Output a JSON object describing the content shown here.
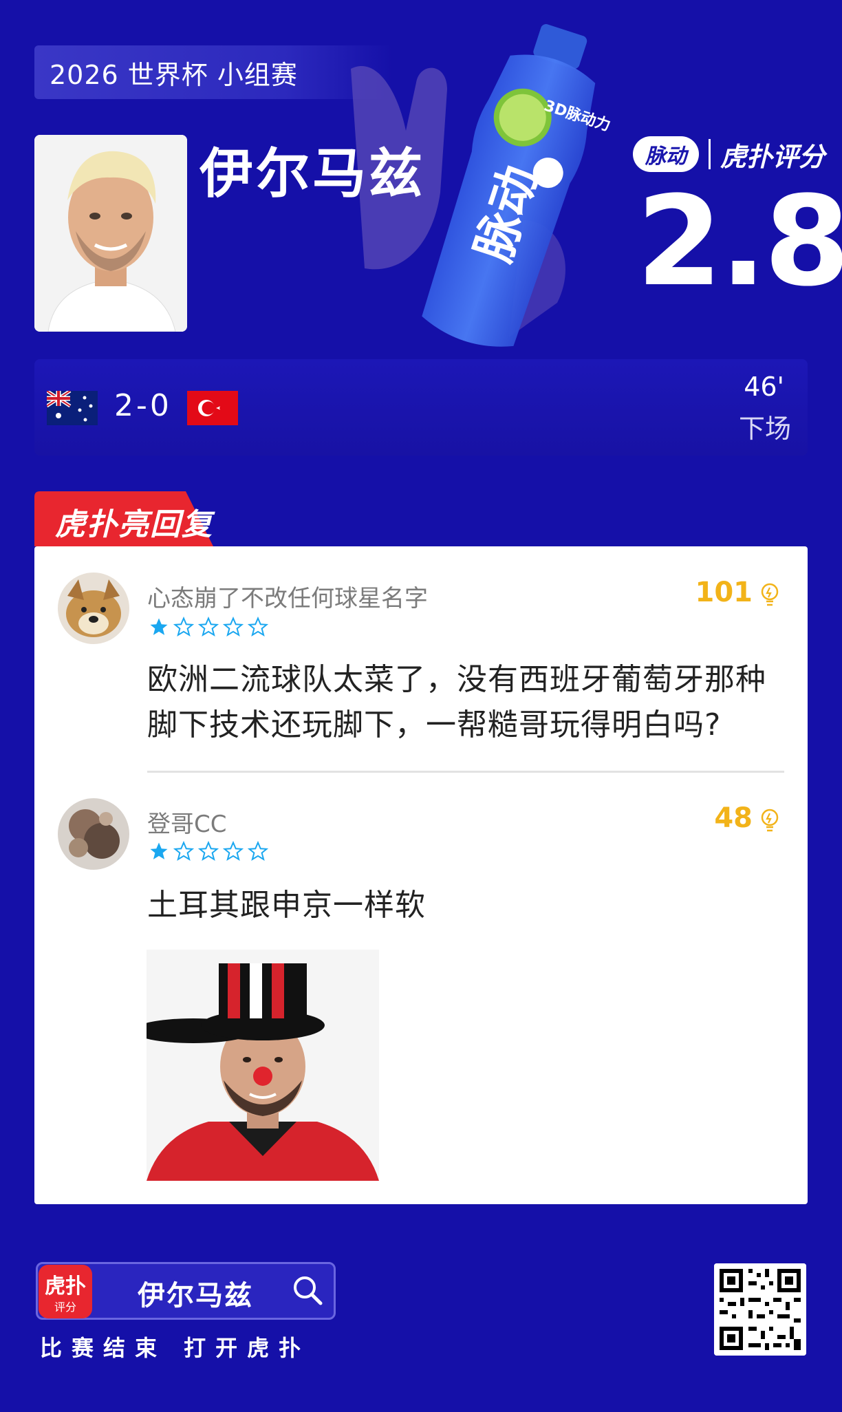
{
  "match": {
    "label": "2026 世界杯 小组赛",
    "score": "2-0",
    "minute": "46'",
    "status": "下场"
  },
  "player": {
    "name": "伊尔马兹",
    "rating": "2.8"
  },
  "brand": {
    "sponsor": "脉动",
    "rating_label": "虎扑评分"
  },
  "ad": {
    "bottle_text": "脉动",
    "badge": "3D脉动力"
  },
  "highlights": {
    "label": "虎扑亮回复"
  },
  "comments": [
    {
      "user": "心态崩了不改任何球星名字",
      "likes": "101",
      "rating_stars": 1,
      "text_line1": "欧洲二流球队太菜了，没有西班牙葡萄牙那种",
      "text_line2": "脚下技术还玩脚下，一帮糙哥玩得明白吗?"
    },
    {
      "user": "登哥CC",
      "likes": "48",
      "rating_stars": 1,
      "text_line1": "土耳其跟申京一样软"
    }
  ],
  "footer": {
    "search_text": "伊尔马兹",
    "app_icon_text": "虎扑",
    "app_icon_sub": "评分",
    "caption": "比赛结束 打开虎扑"
  },
  "colors": {
    "background": "#1510a8",
    "like_gold": "#f2b319",
    "star_blue": "#1aa7f0",
    "tab_red": "#e8262f"
  }
}
